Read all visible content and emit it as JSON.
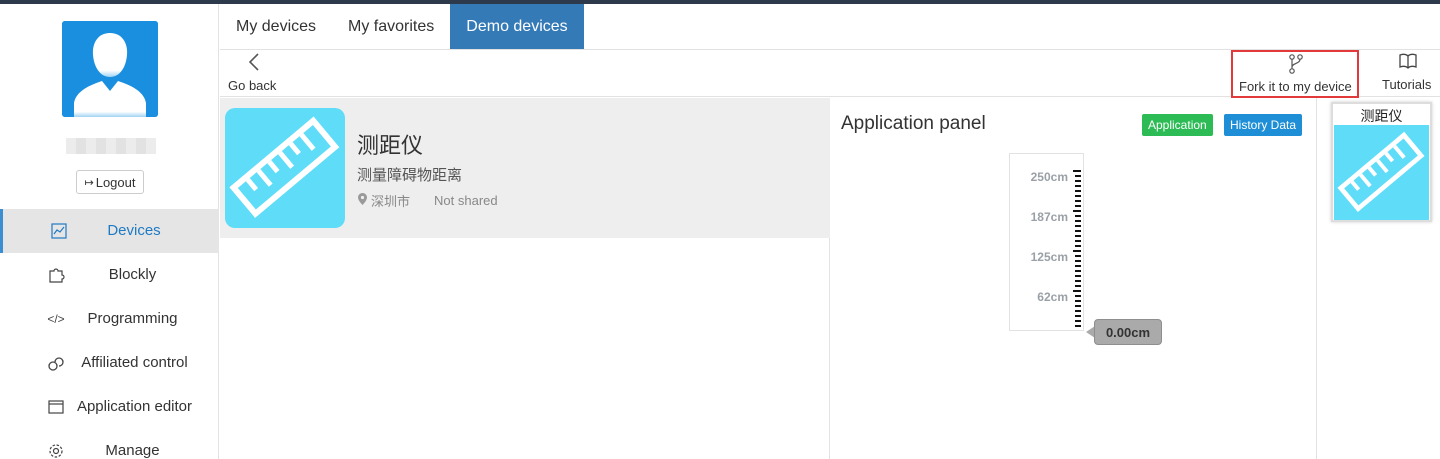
{
  "colors": {
    "accent": "#337ab7",
    "active_nav": "#1f7ac4",
    "device_bg": "#5fdcf8",
    "app_badge": "#2dbb55",
    "history_badge": "#1e8fd6",
    "highlight_box": "#e23a3a",
    "notification_dot": "#e85a8d"
  },
  "sidebar": {
    "logout_label": "Logout",
    "items": [
      {
        "label": "Devices",
        "icon": "chart-icon",
        "active": true
      },
      {
        "label": "Blockly",
        "icon": "puzzle-icon"
      },
      {
        "label": "Programming",
        "icon": "code-icon"
      },
      {
        "label": "Affiliated control",
        "icon": "link-icon"
      },
      {
        "label": "Application editor",
        "icon": "window-icon"
      },
      {
        "label": "Manage",
        "icon": "gear-icon",
        "has_notification": true
      }
    ]
  },
  "tabs": [
    {
      "label": "My devices"
    },
    {
      "label": "My favorites"
    },
    {
      "label": "Demo devices",
      "active": true
    }
  ],
  "toolbar": {
    "go_back": "Go back",
    "fork": "Fork it to my device",
    "tutorials": "Tutorials"
  },
  "device": {
    "name": "测距仪",
    "description": "测量障碍物距离",
    "location": "深圳市",
    "share_status": "Not shared"
  },
  "panel": {
    "title": "Application panel",
    "application_badge": "Application",
    "history_badge": "History Data",
    "gauge_labels": [
      "250cm",
      "187cm",
      "125cm",
      "62cm"
    ],
    "value": "0.00cm",
    "value_numeric": 0,
    "max": 250
  },
  "right_thumb": {
    "title": "测距仪"
  }
}
